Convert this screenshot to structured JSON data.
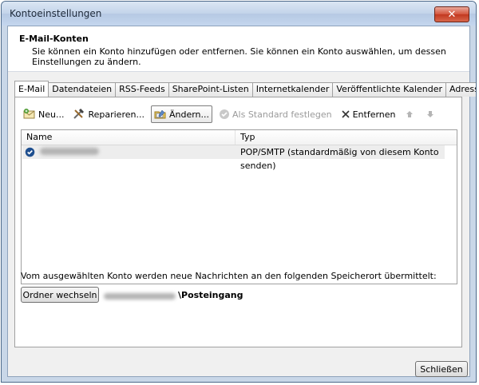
{
  "window": {
    "title": "Kontoeinstellungen",
    "close_glyph": "✕"
  },
  "header": {
    "title": "E-Mail-Konten",
    "description": "Sie können ein Konto hinzufügen oder entfernen. Sie können ein Konto auswählen, um dessen Einstellungen zu ändern."
  },
  "tabs": [
    "E-Mail",
    "Datendateien",
    "RSS-Feeds",
    "SharePoint-Listen",
    "Internetkalender",
    "Veröffentlichte Kalender",
    "Adressbücher"
  ],
  "active_tab": "E-Mail",
  "toolbar": {
    "new_label": "Neu...",
    "repair_label": "Reparieren...",
    "change_label": "Ändern...",
    "set_default_label": "Als Standard festlegen",
    "remove_label": "Entfernen"
  },
  "list": {
    "columns": [
      "Name",
      "Typ"
    ],
    "rows": [
      {
        "type": "POP/SMTP (standardmäßig von diesem Konto senden)"
      }
    ]
  },
  "footer": {
    "info_text": "Vom ausgewählten Konto werden neue Nachrichten an den folgenden Speicherort übermittelt:",
    "change_folder_label": "Ordner wechseln",
    "folder_name": "\\Posteingang",
    "close_label": "Schließen"
  },
  "icons": {
    "new": "envelope-icon",
    "repair": "tools-icon",
    "change": "folder-edit-icon",
    "set_default": "check-circle-icon",
    "remove": "x-icon",
    "move_up": "arrow-up-icon",
    "move_down": "arrow-down-icon",
    "default_account": "check-circle-icon"
  },
  "colors": {
    "accent": "#1f4f8f",
    "close_button": "#c2381f"
  }
}
